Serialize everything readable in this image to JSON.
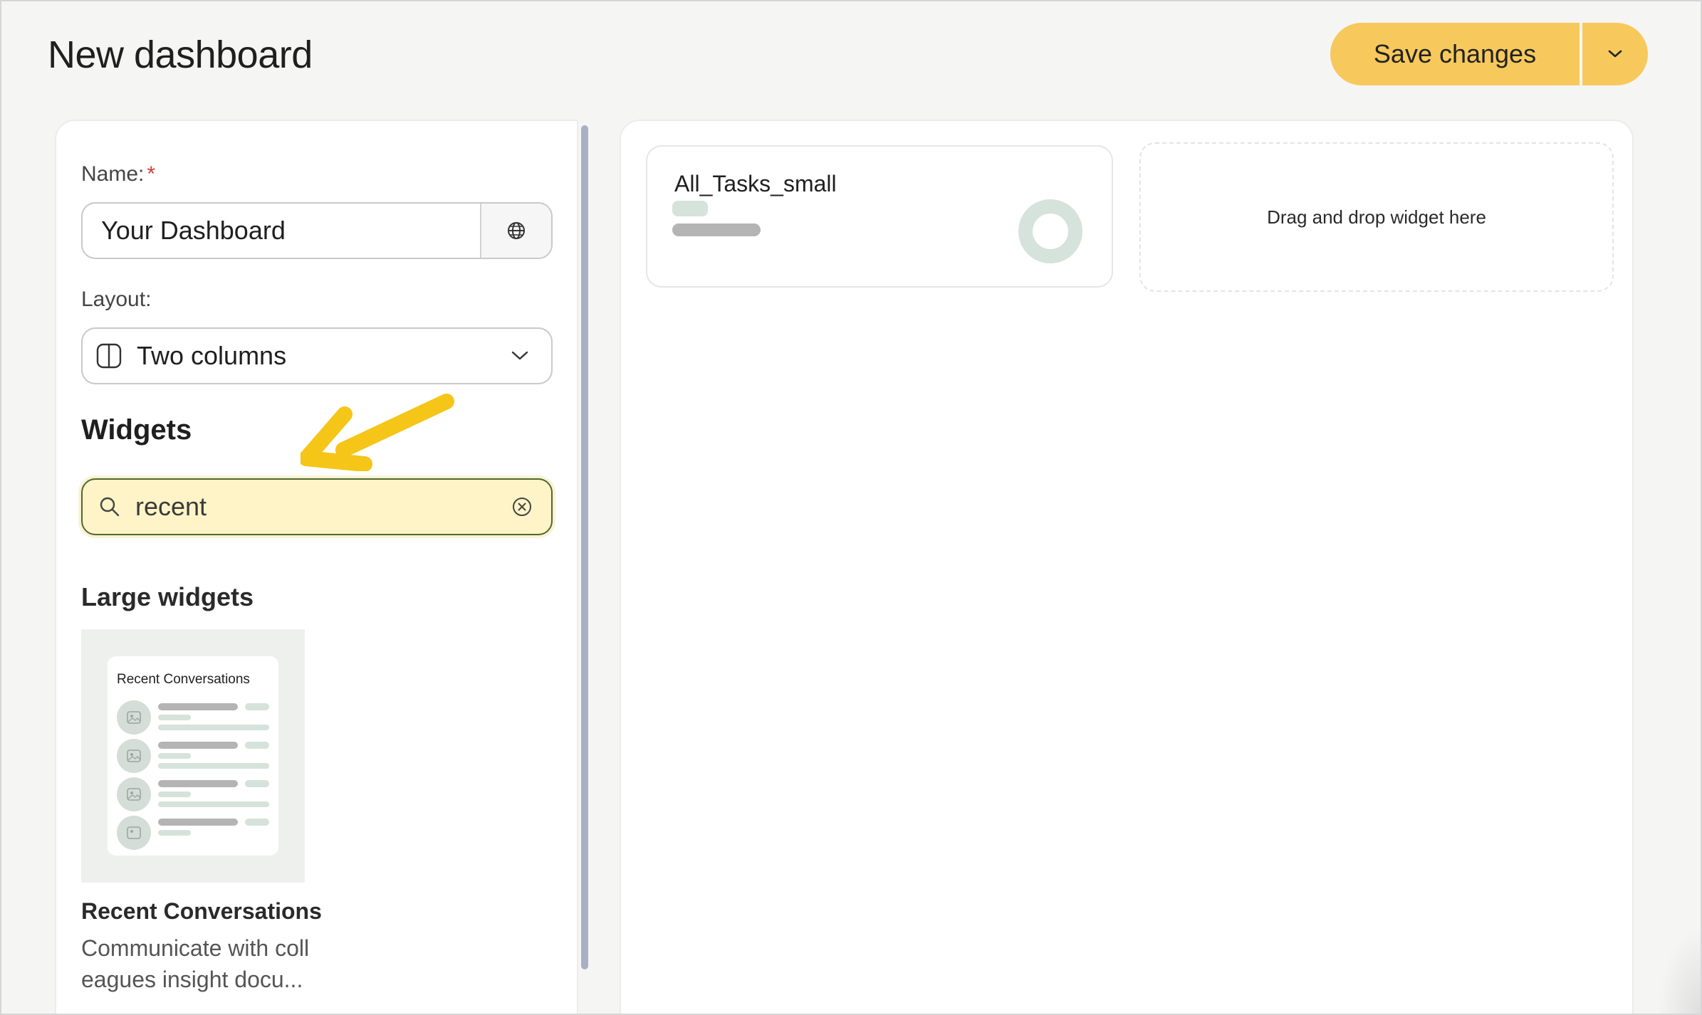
{
  "page": {
    "title": "New dashboard"
  },
  "toolbar": {
    "save_label": "Save changes"
  },
  "form": {
    "name_label": "Name:",
    "required_mark": "*",
    "name_value": "Your Dashboard",
    "layout_label": "Layout:",
    "layout_value": "Two columns"
  },
  "widgets": {
    "section_title": "Widgets",
    "search_value": "recent",
    "large_title": "Large widgets",
    "items": [
      {
        "thumb_title": "Recent Conversations",
        "name": "Recent Conversations",
        "description": "Communicate with coll eagues insight docu..."
      }
    ]
  },
  "canvas": {
    "tile_title": "All_Tasks_small",
    "drop_text": "Drag and drop widget here"
  },
  "icons": {
    "dropdown": "chevron-down-icon",
    "globe": "globe-icon",
    "layout": "two-columns-icon",
    "search": "search-icon",
    "clear": "clear-circle-icon",
    "image": "image-placeholder-icon",
    "annotation": "arrow-annotation-icon"
  },
  "colors": {
    "accent": "#f7c95c",
    "search_bg": "#fff4c8",
    "search_border": "#4c6a2e",
    "arrow": "#f5c518",
    "placeholder_green": "#d4ddd7"
  }
}
